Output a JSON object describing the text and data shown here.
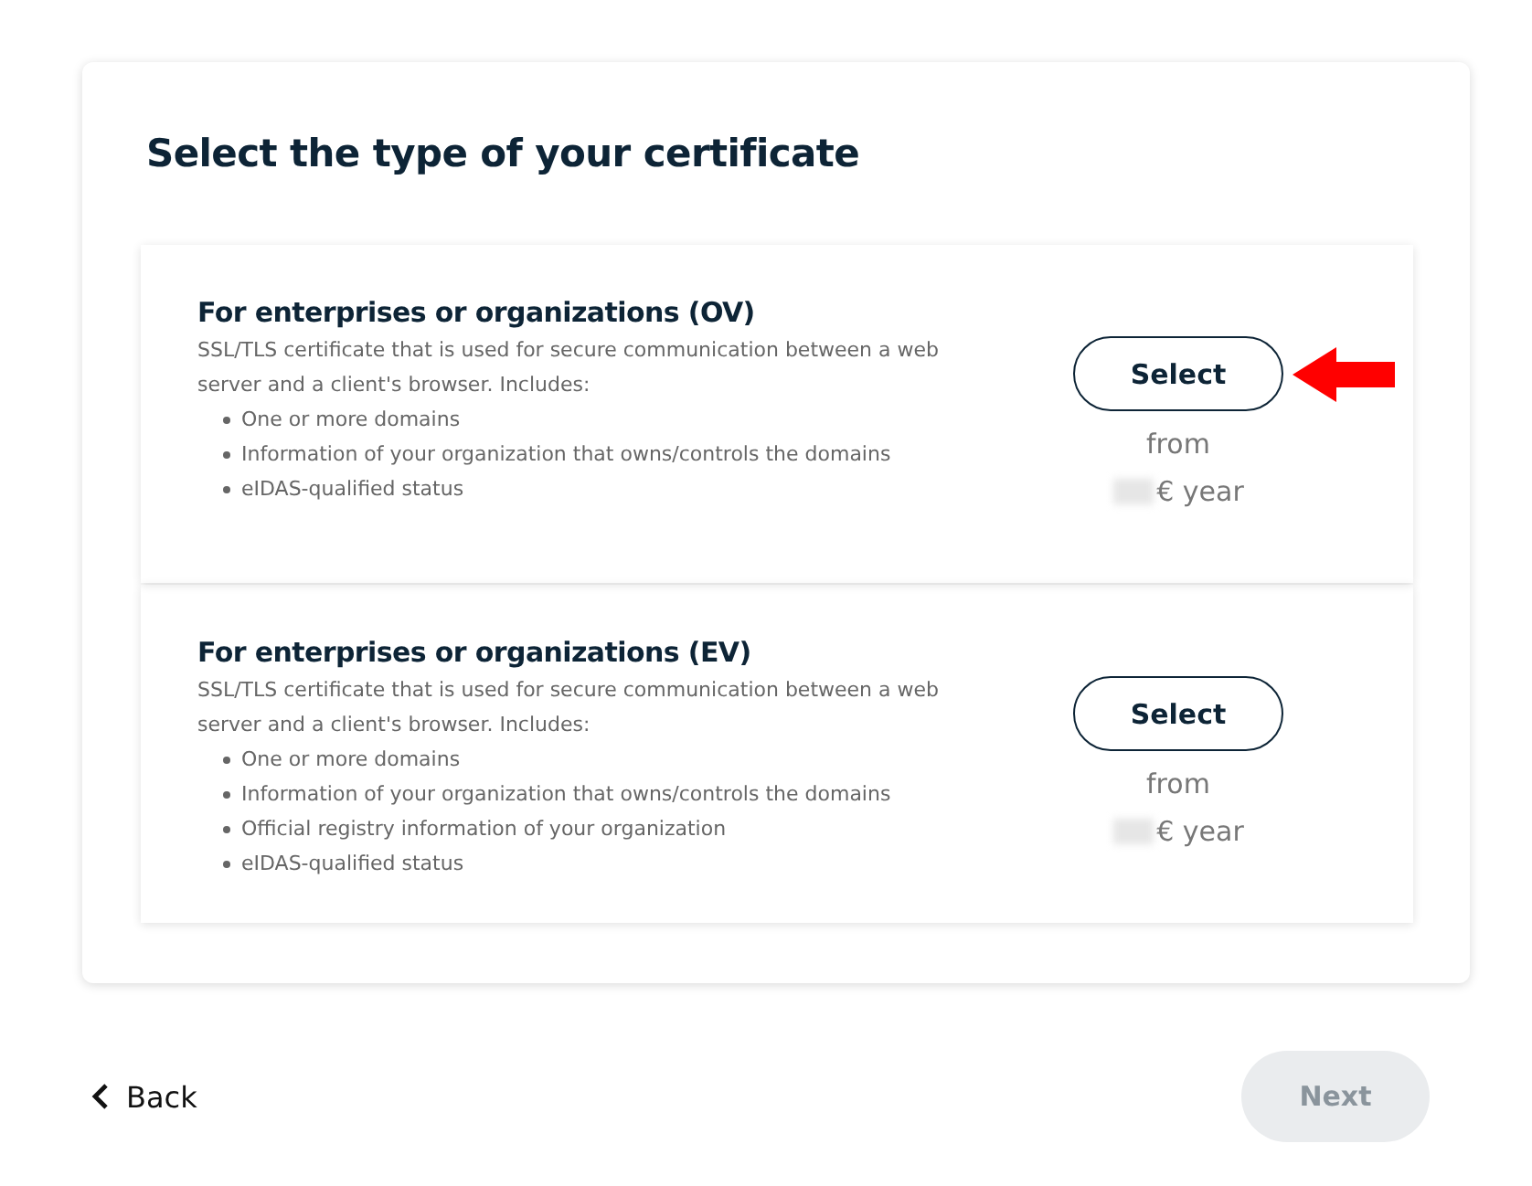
{
  "title": "Select the type of your certificate",
  "options": [
    {
      "title": "For enterprises or organizations (OV)",
      "description": "SSL/TLS certificate that is used for secure communication between a web server and a client's browser. Includes:",
      "features": [
        "One or more domains",
        "Information of your organization that owns/controls the domains",
        "eIDAS-qualified status"
      ],
      "button": "Select",
      "from": "from",
      "price_unit": "€ year",
      "price_hidden": true,
      "pointed": true
    },
    {
      "title": "For enterprises or organizations (EV)",
      "description": "SSL/TLS certificate that is used for secure communication between a web server and a client's browser. Includes:",
      "features": [
        "One or more domains",
        "Information of your organization that owns/controls the domains",
        "Official registry information of your organization",
        "eIDAS-qualified status"
      ],
      "button": "Select",
      "from": "from",
      "price_unit": "€ year",
      "price_hidden": true,
      "pointed": false
    }
  ],
  "back": "Back",
  "next": {
    "label": "Next",
    "disabled": true
  }
}
